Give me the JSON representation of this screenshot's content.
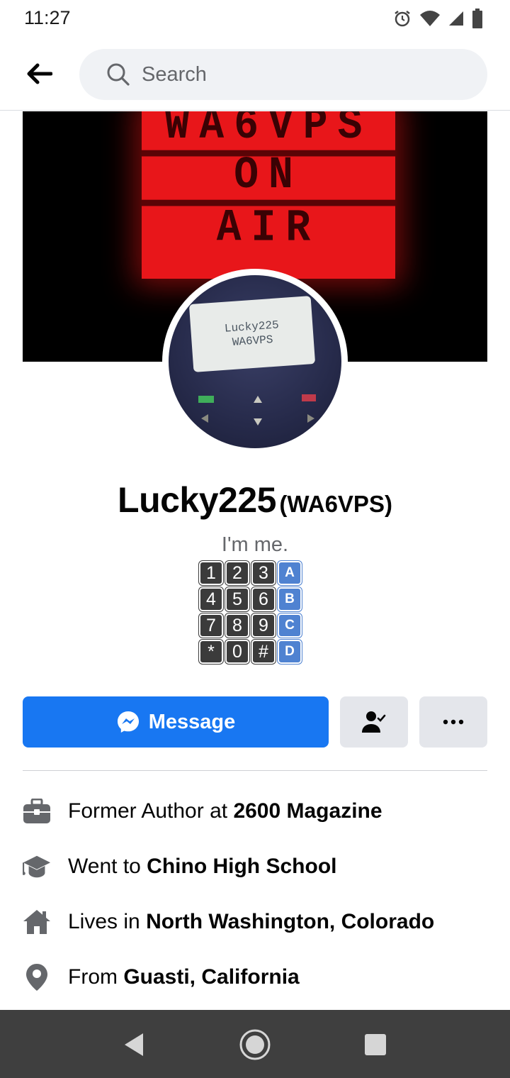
{
  "status_bar": {
    "time": "11:27",
    "icons": [
      "alarm-icon",
      "wifi-icon",
      "signal-icon",
      "battery-icon"
    ]
  },
  "header": {
    "search_placeholder": "Search"
  },
  "cover": {
    "sign_lines": [
      "WA6VPS",
      "ON",
      "AIR"
    ]
  },
  "avatar": {
    "lcd_line1": "Lucky225",
    "lcd_line2": "WA6VPS"
  },
  "profile": {
    "name": "Lucky225",
    "alternate_name": "(WA6VPS)",
    "bio": "I'm me."
  },
  "keypad": {
    "keys": [
      "1",
      "2",
      "3",
      "A",
      "4",
      "5",
      "6",
      "B",
      "7",
      "8",
      "9",
      "C",
      "*",
      "0",
      "#",
      "D"
    ]
  },
  "actions": {
    "message_label": "Message"
  },
  "details": [
    {
      "icon": "briefcase-icon",
      "prefix": "Former Author at ",
      "value": "2600 Magazine"
    },
    {
      "icon": "graduation-cap-icon",
      "prefix": "Went to ",
      "value": "Chino High School"
    },
    {
      "icon": "home-icon",
      "prefix": "Lives in ",
      "value": "North Washington, Colorado"
    },
    {
      "icon": "location-pin-icon",
      "prefix": "From ",
      "value": "Guasti, California"
    }
  ],
  "colors": {
    "primary": "#1877f2",
    "button_gray": "#e4e6eb",
    "secondary_text": "#65676b",
    "nav_bar": "#3f3f3f"
  }
}
